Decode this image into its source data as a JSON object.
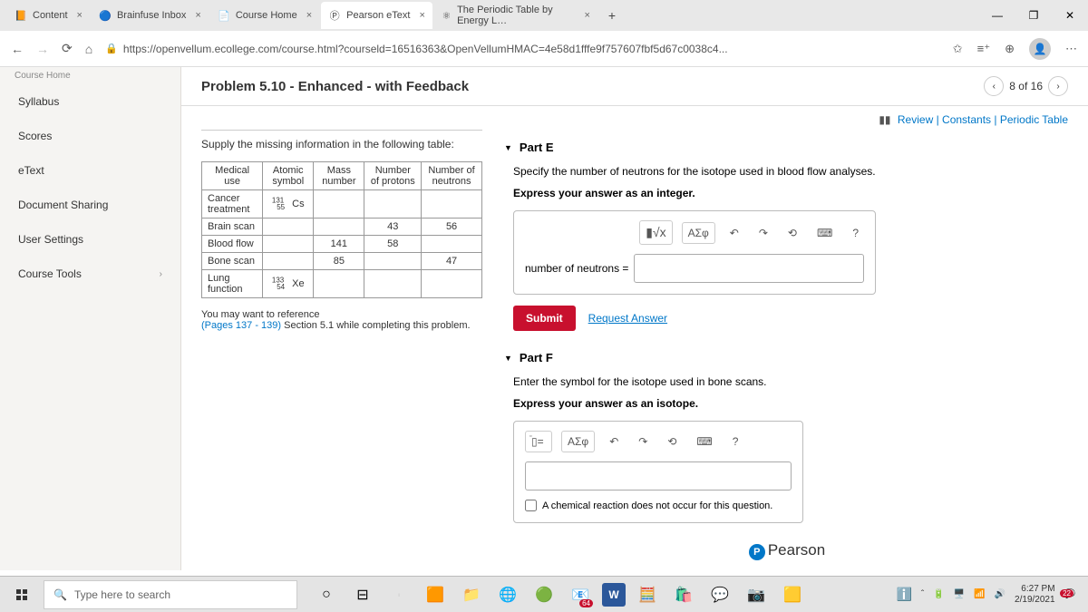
{
  "browser": {
    "tabs": [
      {
        "label": "Content",
        "icon": "📙"
      },
      {
        "label": "Brainfuse Inbox",
        "icon": "🔵"
      },
      {
        "label": "Course Home",
        "icon": "📄"
      },
      {
        "label": "Pearson eText",
        "icon": "Ⓟ"
      },
      {
        "label": "The Periodic Table by Energy L…",
        "icon": "⚛"
      }
    ],
    "url": "https://openvellum.ecollege.com/course.html?courseld=16516363&OpenVellumHMAC=4e58d1fffe9f757607fbf5d67c0038c4..."
  },
  "sidebar": {
    "crumb": "Course Home",
    "items": [
      "Syllabus",
      "Scores",
      "eText",
      "Document Sharing",
      "User Settings",
      "Course Tools"
    ]
  },
  "problem": {
    "title": "Problem 5.10 - Enhanced - with Feedback",
    "pager": "8 of 16",
    "resources": "Review | Constants | Periodic Table",
    "prompt": "Supply the missing information in the following table:",
    "table": {
      "headers": [
        "Medical use",
        "Atomic symbol",
        "Mass number",
        "Number of protons",
        "Number of neutrons"
      ],
      "rows": [
        [
          "Cancer treatment",
          "¹³¹₅₅Cs",
          "",
          "",
          ""
        ],
        [
          "Brain scan",
          "",
          "",
          "43",
          "56"
        ],
        [
          "Blood flow",
          "",
          "141",
          "58",
          ""
        ],
        [
          "Bone scan",
          "",
          "85",
          "",
          "47"
        ],
        [
          "Lung function",
          "¹³³₅₄Xe",
          "",
          "",
          ""
        ]
      ]
    },
    "reference_plain": "You may want to reference",
    "reference_link": "(Pages 137 - 139)",
    "reference_tail": " Section 5.1 while completing this problem."
  },
  "partE": {
    "title": "Part E",
    "question": "Specify the number of neutrons for the isotope used in blood flow analyses.",
    "instruction": "Express your answer as an integer.",
    "label": "number of neutrons =",
    "toolbar": {
      "frac": "√x",
      "greek": "ΑΣφ",
      "undo": "↶",
      "redo": "↷",
      "reset": "⟲",
      "keyboard": "⌨",
      "help": "?"
    },
    "submit": "Submit",
    "request": "Request Answer"
  },
  "partF": {
    "title": "Part F",
    "question": "Enter the symbol for the isotope used in bone scans.",
    "instruction": "Express your answer as an isotope.",
    "toolbar": {
      "greek": "ΑΣφ",
      "undo": "↶",
      "redo": "↷",
      "reset": "⟲",
      "keyboard": "⌨",
      "help": "?"
    },
    "checkbox": "A chemical reaction does not occur for this question."
  },
  "footer_brand": "Pearson",
  "taskbar": {
    "search_placeholder": "Type here to search",
    "time": "6:27 PM",
    "date": "2/19/2021",
    "badge": "64",
    "notif": "22"
  }
}
